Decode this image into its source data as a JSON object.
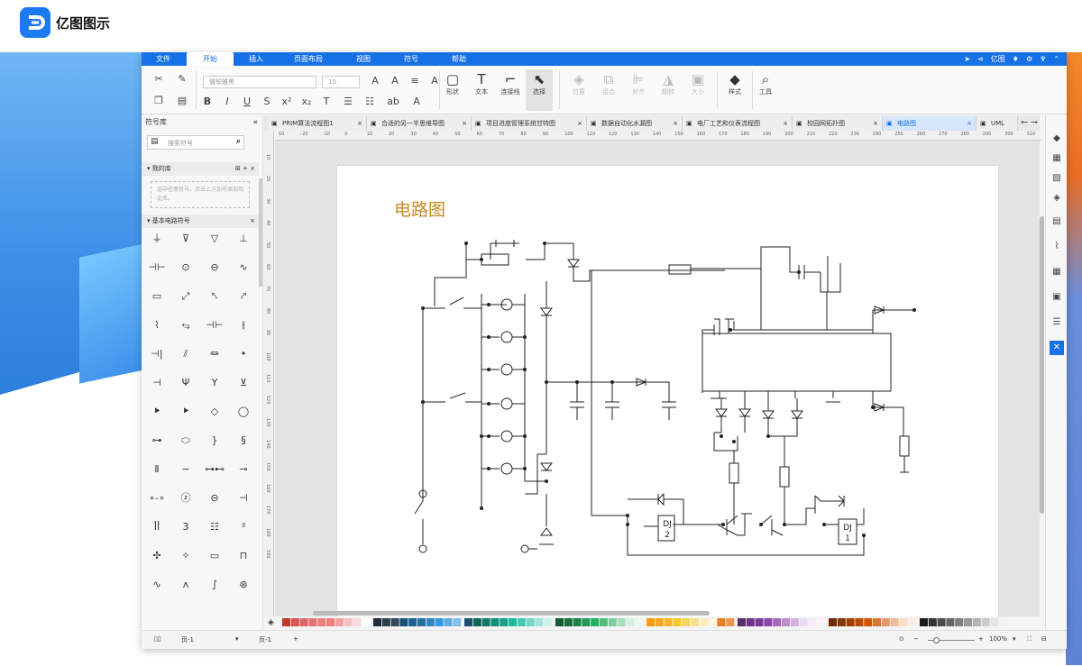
{
  "site": {
    "title": "亿图图示",
    "logo": "edraw-logo-icon"
  },
  "app": {
    "menu": [
      {
        "label": "文件"
      },
      {
        "label": "开始"
      },
      {
        "label": "插入"
      },
      {
        "label": "页面布局"
      },
      {
        "label": "视图"
      },
      {
        "label": "符号"
      },
      {
        "label": "帮助"
      }
    ],
    "active_menu": "开始",
    "user_label": "亿图",
    "ribbon": {
      "font_family": "微软雅黑",
      "font_size": "10",
      "tools": [
        {
          "label": "形状"
        },
        {
          "label": "文本"
        },
        {
          "label": "连接线"
        },
        {
          "label": "选择"
        }
      ],
      "arrange": [
        {
          "label": "位置"
        },
        {
          "label": "组合"
        },
        {
          "label": "对齐"
        },
        {
          "label": "翻转"
        },
        {
          "label": "大小"
        }
      ],
      "style_label": "样式",
      "tool_label": "工具"
    },
    "sidebar": {
      "title": "符号库",
      "search_placeholder": "搜索符号",
      "my_library": "我的库",
      "my_library_hint": "选中任意符号，点击上方加号添加到此库。",
      "basic_circuit": "基本电路符号"
    },
    "tabs": [
      {
        "label": "PRIM算法流程图1"
      },
      {
        "label": "合适的另一半思维导图"
      },
      {
        "label": "项目进度管理系统甘特图"
      },
      {
        "label": "数据自动化水漏图"
      },
      {
        "label": "电厂工艺和仪表流程图"
      },
      {
        "label": "校园网拓扑图"
      },
      {
        "label": "电路图"
      },
      {
        "label": "UML"
      }
    ],
    "active_tab": "电路图",
    "ruler_h": [
      "10",
      "-20",
      "-10",
      "0",
      "10",
      "20",
      "30",
      "40",
      "50",
      "60",
      "70",
      "80",
      "90",
      "100",
      "110",
      "120",
      "130",
      "140",
      "150",
      "160",
      "170",
      "180",
      "190",
      "200",
      "210",
      "220",
      "230",
      "240",
      "250",
      "260",
      "270",
      "280",
      "290",
      "300",
      "310"
    ],
    "ruler_v": [
      "10",
      "20",
      "30",
      "40",
      "50",
      "60",
      "70",
      "80",
      "90",
      "100",
      "110",
      "120",
      "130",
      "140",
      "150",
      "160",
      "170",
      "180",
      "190"
    ],
    "diagram": {
      "title": "电路图",
      "relay1": {
        "line1": "DJ",
        "line2": "2"
      },
      "relay2": {
        "line1": "DJ",
        "line2": "1"
      }
    },
    "status": {
      "page_selector": "页-1",
      "page_tab": "页-1",
      "zoom": "100%"
    },
    "palette": [
      "#c0392b",
      "#d9534f",
      "#e06666",
      "#e57373",
      "#ea8080",
      "#f08080",
      "#f4a3a3",
      "#f7c0c0",
      "#fadada",
      "#ffffff",
      "#1f2d3d",
      "#2c3e50",
      "#34495e",
      "#1a5276",
      "#1f618d",
      "#2471a3",
      "#2e86c1",
      "#3498db",
      "#5dade2",
      "#85c1e9",
      "#1b4f72",
      "#0e6655",
      "#117864",
      "#138d75",
      "#16a085",
      "#1abc9c",
      "#48c9b0",
      "#76d7c4",
      "#a3e4d7",
      "#d1f2eb",
      "#145a32",
      "#196f3d",
      "#1e8449",
      "#229954",
      "#27ae60",
      "#52be80",
      "#7dcea0",
      "#a9dfbf",
      "#d4efdf",
      "#e9f7ef",
      "#f39c12",
      "#f5a623",
      "#f7b731",
      "#f9ca24",
      "#f6d55c",
      "#f8e08e",
      "#fbeec1",
      "#fdf5e0",
      "#e67e22",
      "#eb984e",
      "#5b2c6f",
      "#6c3483",
      "#7d3c98",
      "#8e44ad",
      "#a569bd",
      "#bb8fce",
      "#d2b4de",
      "#e8daef",
      "#f5eef8",
      "#fdf2f8",
      "#6e2c00",
      "#873600",
      "#a04000",
      "#ba4a00",
      "#d35400",
      "#dc7633",
      "#e59866",
      "#edbb99",
      "#f6ddcc",
      "#fbeee6",
      "#1c1c1c",
      "#333333",
      "#4d4d4d",
      "#666666",
      "#808080",
      "#999999",
      "#b3b3b3",
      "#cccccc",
      "#e6e6e6",
      "#f2f2f2"
    ]
  }
}
